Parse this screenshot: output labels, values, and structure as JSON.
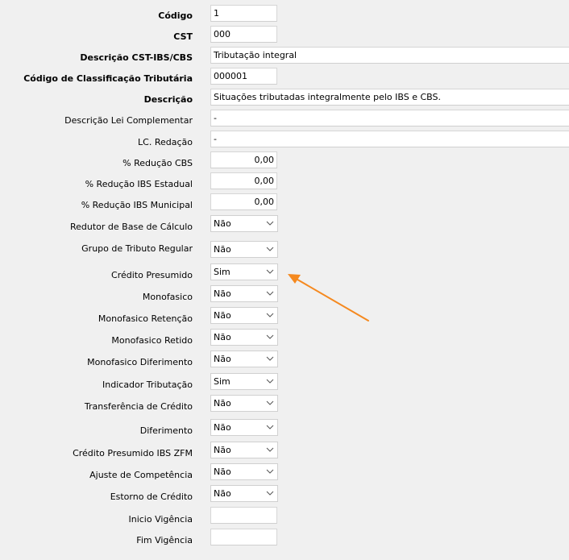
{
  "form": {
    "codigo": {
      "label": "Código",
      "value": "1"
    },
    "cst": {
      "label": "CST",
      "value": "000"
    },
    "descricao_cst": {
      "label": "Descrição CST-IBS/CBS",
      "value": "Tributação integral"
    },
    "codigo_class": {
      "label": "Código de Classificação Tributária",
      "value": "000001"
    },
    "descricao": {
      "label": "Descrição",
      "value": "Situações tributadas integralmente pelo IBS e CBS."
    },
    "descricao_lei": {
      "label": "Descrição Lei Complementar",
      "value": "-"
    },
    "lc_redacao": {
      "label": "LC. Redação",
      "value": "-"
    },
    "reducao_cbs": {
      "label": "% Redução CBS",
      "value": "0,00"
    },
    "reducao_ibs_est": {
      "label": "% Redução IBS Estadual",
      "value": "0,00"
    },
    "reducao_ibs_mun": {
      "label": "% Redução IBS Municipal",
      "value": "0,00"
    },
    "redutor_base": {
      "label": "Redutor de Base de Cálculo",
      "value": "Não"
    },
    "grupo_tributo": {
      "label": "Grupo de Tributo Regular",
      "value": "Não"
    },
    "credito_presumido": {
      "label": "Crédito Presumido",
      "value": "Sim"
    },
    "monofasico": {
      "label": "Monofasico",
      "value": "Não"
    },
    "monofasico_retencao": {
      "label": "Monofasico Retenção",
      "value": "Não"
    },
    "monofasico_retido": {
      "label": "Monofasico Retido",
      "value": "Não"
    },
    "monofasico_diferimento": {
      "label": "Monofasico Diferimento",
      "value": "Não"
    },
    "indicador_tributacao": {
      "label": "Indicador Tributação",
      "value": "Sim"
    },
    "transferencia_credito": {
      "label": "Transferência de Crédito",
      "value": "Não"
    },
    "diferimento": {
      "label": "Diferimento",
      "value": "Não"
    },
    "credito_presumido_zfm": {
      "label": "Crédito Presumido IBS ZFM",
      "value": "Não"
    },
    "ajuste_competencia": {
      "label": "Ajuste de Competência",
      "value": "Não"
    },
    "estorno_credito": {
      "label": "Estorno de Crédito",
      "value": "Não"
    },
    "inicio_vigencia": {
      "label": "Inicio Vigência",
      "value": ""
    },
    "fim_vigencia": {
      "label": "Fim Vigência",
      "value": ""
    }
  },
  "colors": {
    "annotation_arrow": "#f5891f",
    "background": "#f0f0f0"
  },
  "icons": {
    "dropdown": "chevron-down-icon"
  }
}
